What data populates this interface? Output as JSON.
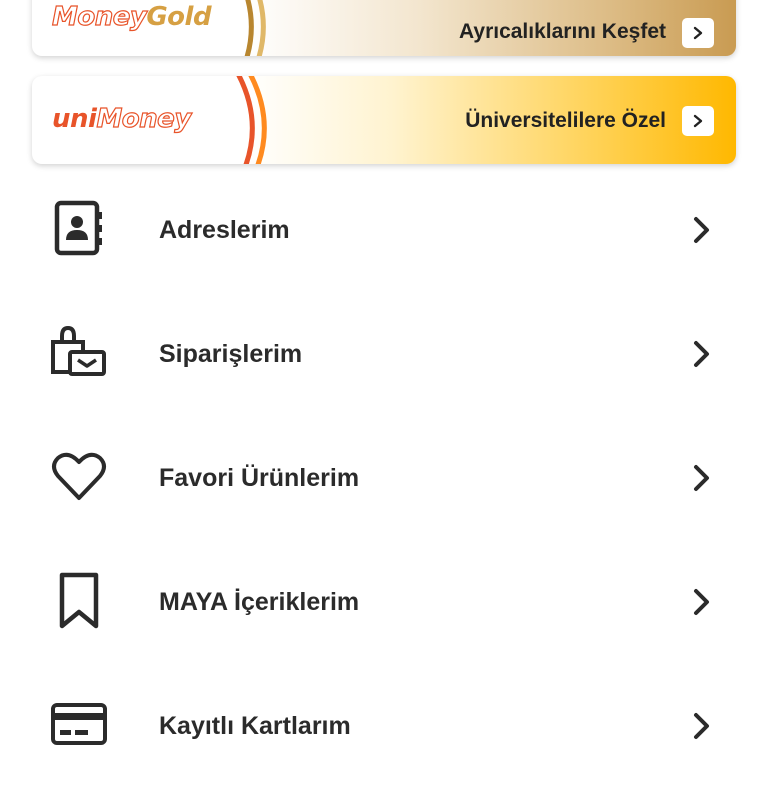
{
  "banners": {
    "gold": {
      "logo_part1": "Money",
      "logo_part2": "Gold",
      "text": "Ayrıcalıklarını Keşfet"
    },
    "uni": {
      "logo_part1": "uni",
      "logo_part2": "Money",
      "text": "Üniversitelilere Özel"
    }
  },
  "menu": {
    "items": [
      {
        "label": "Adreslerim",
        "icon": "address-book-icon"
      },
      {
        "label": "Siparişlerim",
        "icon": "shopping-bag-icon"
      },
      {
        "label": "Favori Ürünlerim",
        "icon": "heart-icon"
      },
      {
        "label": "MAYA İçeriklerim",
        "icon": "bookmark-icon"
      },
      {
        "label": "Kayıtlı Kartlarım",
        "icon": "credit-card-icon"
      }
    ]
  },
  "colors": {
    "brand_orange": "#e8542a",
    "gold": "#d6a043",
    "uni_yellow": "#ffb800",
    "text_dark": "#2b2b2b"
  }
}
